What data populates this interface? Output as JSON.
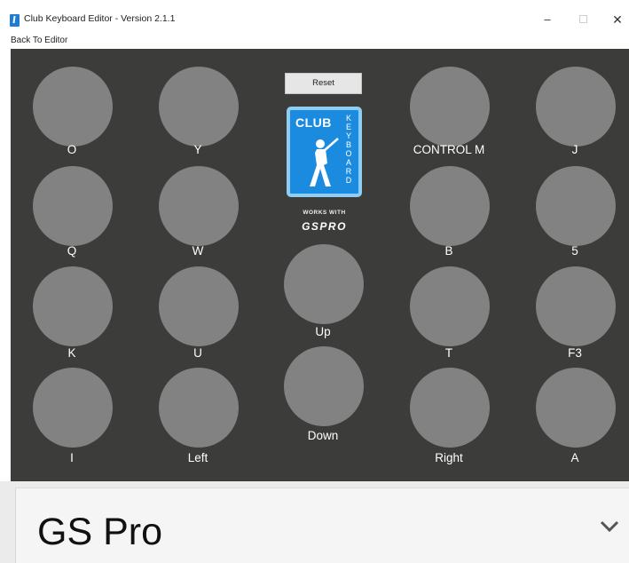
{
  "window": {
    "title": "Club Keyboard Editor - Version 2.1.1",
    "minimize": "–",
    "close": "✕"
  },
  "menu": {
    "back": "Back To Editor"
  },
  "reset_label": "Reset",
  "logo": {
    "club": "CLUB",
    "keyboard": "KEYBOARD",
    "works_with": "WORKS WITH",
    "gspro": "GSPRO"
  },
  "keys": [
    {
      "label": "O"
    },
    {
      "label": "Y"
    },
    {
      "label": "CONTROL M"
    },
    {
      "label": "J"
    },
    {
      "label": "Q"
    },
    {
      "label": "W"
    },
    {
      "label": "B"
    },
    {
      "label": "5"
    },
    {
      "label": "K"
    },
    {
      "label": "U"
    },
    {
      "label": "Up"
    },
    {
      "label": "T"
    },
    {
      "label": "F3"
    },
    {
      "label": "I"
    },
    {
      "label": "Left"
    },
    {
      "label": "Down"
    },
    {
      "label": "Right"
    },
    {
      "label": "A"
    }
  ],
  "profile_select": {
    "value": "GS Pro",
    "icon": "chevron-down-icon"
  }
}
